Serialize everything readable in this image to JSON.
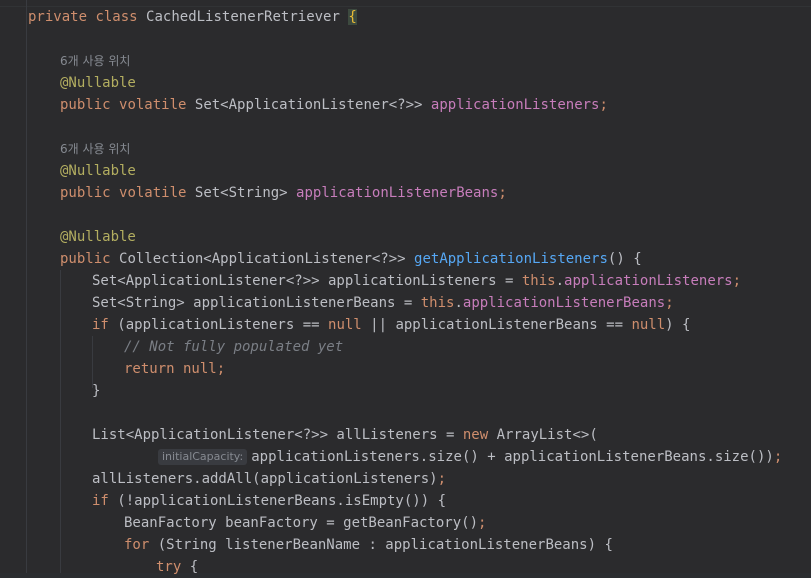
{
  "code": {
    "class_decl": {
      "kw1": "private",
      "kw2": "class",
      "name": "CachedListenerRetriever",
      "brace": "{"
    },
    "usage_hint_1": "6개 사용 위치",
    "ann_1": "@Nullable",
    "field1": {
      "kw1": "public",
      "kw2": "volatile",
      "type": "Set<ApplicationListener<?>>",
      "name": "applicationListeners",
      "semi": ";"
    },
    "usage_hint_2": "6개 사용 위치",
    "ann_2": "@Nullable",
    "field2": {
      "kw1": "public",
      "kw2": "volatile",
      "type": "Set<String>",
      "name": "applicationListenerBeans",
      "semi": ";"
    },
    "ann_3": "@Nullable",
    "method": {
      "kw1": "public",
      "type": "Collection<ApplicationListener<?>>",
      "name": "getApplicationListeners",
      "rest": "() {"
    },
    "l1": {
      "a": "Set<ApplicationListener<?>> applicationListeners = ",
      "kw": "this",
      "dot": ".",
      "f": "applicationListeners",
      "semi": ";"
    },
    "l2": {
      "a": "Set<String> applicationListenerBeans = ",
      "kw": "this",
      "dot": ".",
      "f": "applicationListenerBeans",
      "semi": ";"
    },
    "l3": {
      "kw": "if",
      "a": " (applicationListeners == ",
      "n1": "null",
      "b": " || applicationListenerBeans == ",
      "n2": "null",
      "c": ") {"
    },
    "l4": {
      "comment": "// Not fully populated yet"
    },
    "l5": {
      "kw": "return",
      "n": " null",
      "semi": ";"
    },
    "l6": {
      "close": "}"
    },
    "l7": {
      "a": "List<ApplicationListener<?>> allListeners = ",
      "kw": "new",
      "b": " ArrayList<>("
    },
    "l8": {
      "hint": "initialCapacity:",
      "a": "applicationListeners.size() + applicationListenerBeans.size())",
      "semi": ";"
    },
    "l9": {
      "a": "allListeners.addAll(applicationListeners)",
      "semi": ";"
    },
    "l10": {
      "kw": "if",
      "a": " (!applicationListenerBeans.isEmpty()) {"
    },
    "l11": {
      "a": "BeanFactory beanFactory = getBeanFactory()",
      "semi": ";"
    },
    "l12": {
      "kw": "for",
      "a": " (String listenerBeanName : applicationListenerBeans) {"
    },
    "l13": {
      "kw": "try",
      "a": " {"
    }
  }
}
